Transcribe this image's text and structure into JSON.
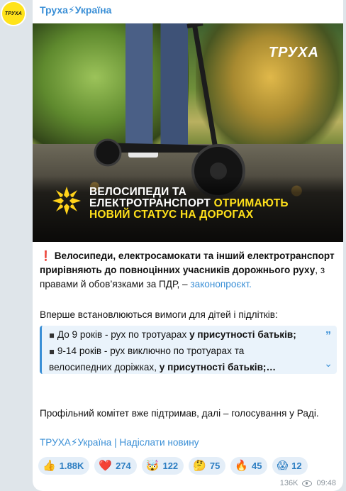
{
  "channel": {
    "avatar_text": "ТРУХА",
    "name": "Труха⚡Україна"
  },
  "post": {
    "image": {
      "brand": "ТРУХА",
      "headline_line1": "Велосипеди та",
      "headline_line2_a": "електротранспорт ",
      "headline_line2_b": "отримають",
      "headline_line3": "новий статус на дорогах"
    },
    "paragraph1": {
      "emoji": "❗",
      "bold": "Велосипеди, електросамокати та інший електротранспорт прирівняють до повноцінних учасників дорожнього руху",
      "rest": ", з правами й обов’язками за ПДР, – ",
      "link": "законопроєкт."
    },
    "paragraph2": "Вперше встановлюються вимоги для дітей і підлітків:",
    "quote": {
      "line1_a": "До 9 років - рух по тротуарах ",
      "line1_b": "у присутності батьків;",
      "line2": "9-14 років - рух виключно по тротуарах та",
      "line3_a": "велосипедних доріжках, ",
      "line3_b": "у присутності батьків;…"
    },
    "paragraph3": "Профільний комітет вже підтримав, далі – голосування у Раді.",
    "footer_link": "ТРУХА⚡Україна | Надіслати новину",
    "reactions": [
      {
        "emoji": "👍",
        "count": "1.88K"
      },
      {
        "emoji": "❤️",
        "count": "274"
      },
      {
        "emoji": "🤯",
        "count": "122"
      },
      {
        "emoji": "🤔",
        "count": "75"
      },
      {
        "emoji": "🔥",
        "count": "45"
      },
      {
        "emoji": "😱",
        "count": "12"
      }
    ],
    "views": "136K",
    "time": "09:48"
  }
}
